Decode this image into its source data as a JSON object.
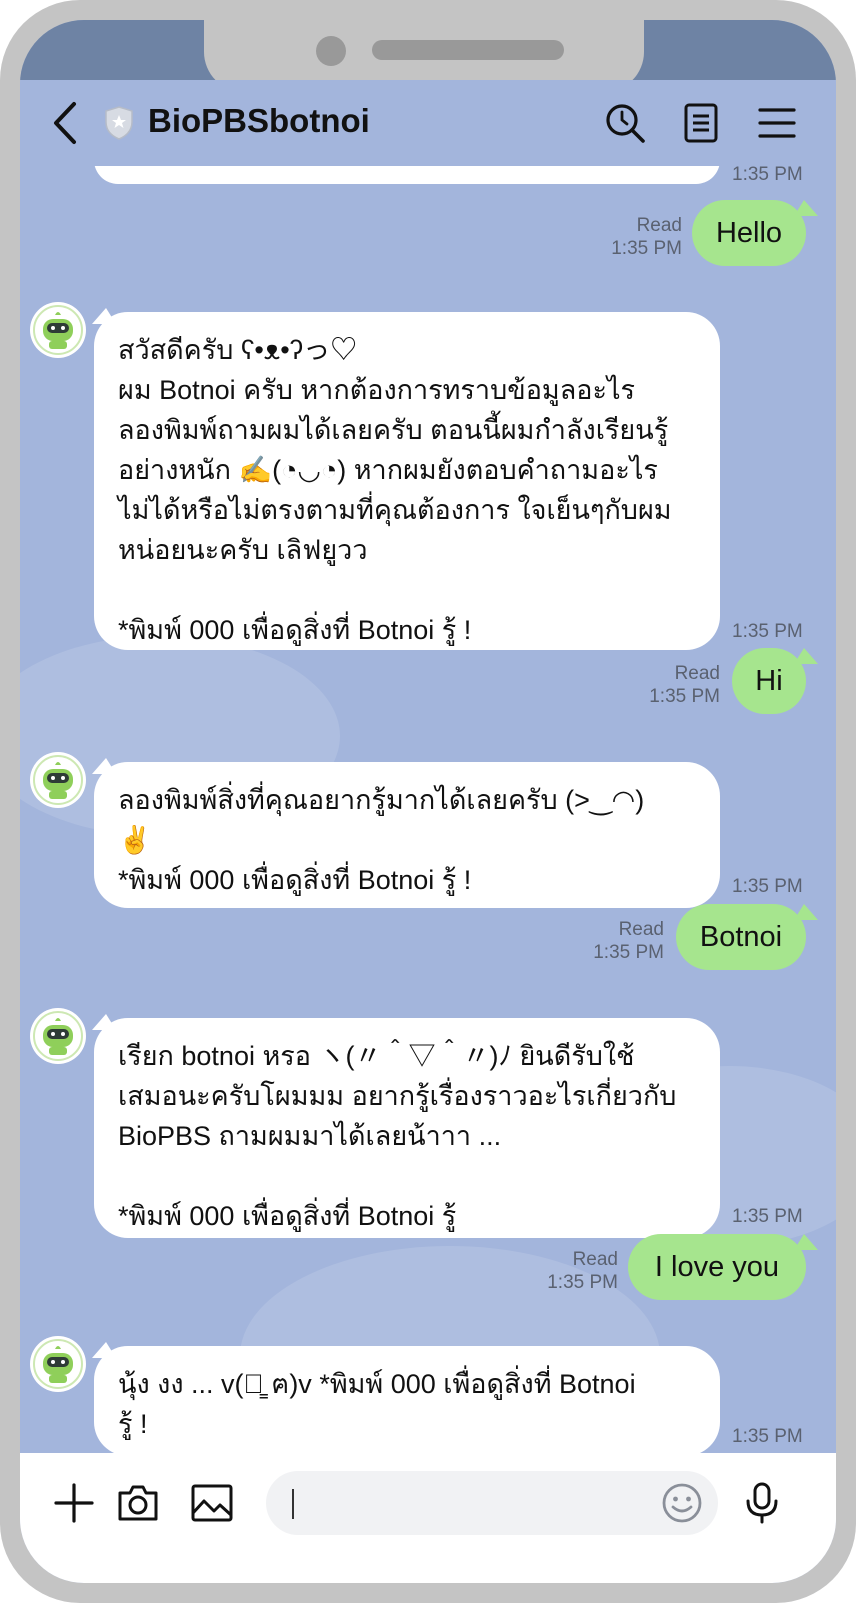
{
  "app": {
    "title": "BioPBSbotnoi"
  },
  "header": {
    "title": "BioPBSbotnoi",
    "icons": [
      "back-icon",
      "shield-icon",
      "search-icon",
      "notes-icon",
      "menu-icon"
    ]
  },
  "messages": {
    "top_partial_time": "1:35 PM",
    "m1": {
      "text": "Hello",
      "read": "Read",
      "time": "1:35 PM"
    },
    "m2": {
      "text": "สวัสดีครับ ʕ•ᴥ•ʔっ♡\nผม Botnoi ครับ หากต้องการทราบข้อมูลอะไร\nลองพิมพ์ถามผมได้เลยครับ ตอนนี้ผมกำลังเรียนรู้\nอย่างหนัก ✍️(◔◡◔) หากผมยังตอบคำถามอะไร\nไม่ได้หรือไม่ตรงตามที่คุณต้องการ ใจเย็นๆกับผม\nหน่อยนะครับ เลิฟยูวว\n\n*พิมพ์ 000 เพื่อดูสิ่งที่ Botnoi รู้ !",
      "time": "1:35 PM"
    },
    "m3": {
      "text": "Hi",
      "read": "Read",
      "time": "1:35 PM"
    },
    "m4": {
      "text": "ลองพิมพ์สิ่งที่คุณอยากรู้มากได้เลยครับ (>‿◠)\n✌️\n*พิมพ์ 000 เพื่อดูสิ่งที่ Botnoi รู้ !",
      "time": "1:35 PM"
    },
    "m5": {
      "text": "Botnoi",
      "read": "Read",
      "time": "1:35 PM"
    },
    "m6": {
      "text": "เรียก botnoi หรอ ヽ(〃＾▽＾〃)ﾉ ยินดีรับใช้\nเสมอนะครับโผมมม อยากรู้เรื่องราวอะไรเกี่ยวกับ\nBioPBS ถามผมมาได้เลยน้าาา ...\n\n*พิมพ์ 000 เพื่อดูสิ่งที่ Botnoi รู้",
      "time": "1:35 PM"
    },
    "m7": {
      "text": "I love you",
      "read": "Read",
      "time": "1:35 PM"
    },
    "m8": {
      "text": "นุ้ง งง ... v(ฅ̳ ฅ)v *พิมพ์ 000 เพื่อดูสิ่งที่ Botnoi\nรู้ !",
      "time": "1:35 PM"
    }
  },
  "input": {
    "value": "",
    "placeholder": ""
  },
  "colors": {
    "chat_bg": "#a3b5dc",
    "outgoing_bubble": "#a6e58e",
    "incoming_bubble": "#ffffff"
  }
}
